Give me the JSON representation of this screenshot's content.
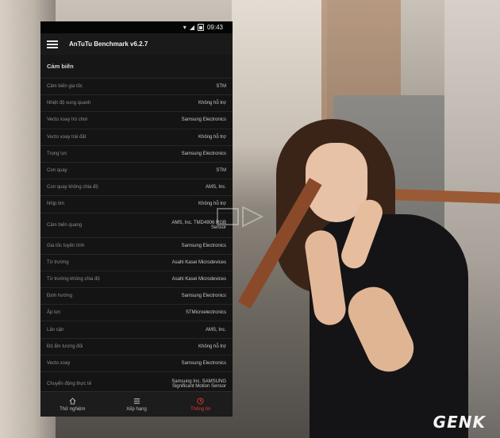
{
  "status_bar": {
    "time": "09:43"
  },
  "app": {
    "title": "AnTuTu Benchmark v6.2.7"
  },
  "section": {
    "title": "Cảm biến"
  },
  "rows": [
    {
      "label": "Cảm biến gia tốc",
      "value": "STM"
    },
    {
      "label": "Nhiệt độ xung quanh",
      "value": "Không hỗ trợ"
    },
    {
      "label": "Vecto xoay trò chơi",
      "value": "Samsung Electronics"
    },
    {
      "label": "Vecto xoay trái đất",
      "value": "Không hỗ trợ"
    },
    {
      "label": "Trọng lực",
      "value": "Samsung Electronics"
    },
    {
      "label": "Con quay",
      "value": "STM"
    },
    {
      "label": "Con quay không chia độ",
      "value": "AMS, Inc."
    },
    {
      "label": "Nhịp tim",
      "value": "Không hỗ trợ"
    },
    {
      "label": "Cảm biến quang",
      "value": "AMS, Inc. TMD4906 RGB Sensor"
    },
    {
      "label": "Gia tốc tuyến tính",
      "value": "Samsung Electronics"
    },
    {
      "label": "Từ trường",
      "value": "Asahi Kasei Microdevices"
    },
    {
      "label": "Từ trường không chia độ",
      "value": "Asahi Kasei Microdevices"
    },
    {
      "label": "Định hướng",
      "value": "Samsung Electronics"
    },
    {
      "label": "Áp lực",
      "value": "STMicroelectronics"
    },
    {
      "label": "Lân cận",
      "value": "AMS, Inc."
    },
    {
      "label": "Độ ẩm tương đối",
      "value": "Không hỗ trợ"
    },
    {
      "label": "Vecto xoay",
      "value": "Samsung Electronics"
    },
    {
      "label": "Chuyển động thực tế",
      "value": "Samsung Inc. SAMSUNG Significant Motion Sensor"
    }
  ],
  "bottom_nav": [
    {
      "label": "Thử nghiệm",
      "icon": "home-icon",
      "active": false
    },
    {
      "label": "Xếp hạng",
      "icon": "list-icon",
      "active": false
    },
    {
      "label": "Thông tin",
      "icon": "clock-icon",
      "active": true
    }
  ],
  "colors": {
    "active": "#e53935",
    "background": "#111111"
  },
  "watermark": {
    "text": "GENK"
  }
}
